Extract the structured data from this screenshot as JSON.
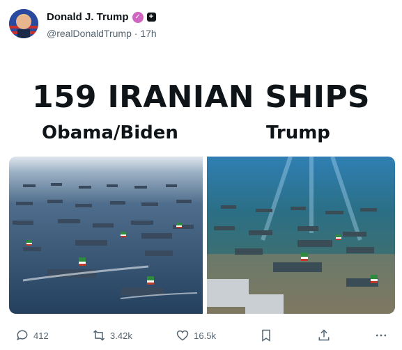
{
  "post": {
    "author_name": "Donald J. Trump",
    "handle": "@realDonaldTrump",
    "separator": "·",
    "time": "17h",
    "verified_badge_icon": "verified-badge-icon",
    "plus_icon": "plus-badge-icon",
    "plus_symbol": "+"
  },
  "media": {
    "headline": "159 IRANIAN SHIPS",
    "left_label": "Obama/Biden",
    "right_label": "Trump",
    "left_image": "fleet-of-iranian-ships-sailing",
    "right_image": "sunken-iranian-ships-on-seafloor"
  },
  "actions": {
    "reply_count": "412",
    "repost_count": "3.42k",
    "like_count": "16.5k",
    "reply_icon": "reply-icon",
    "repost_icon": "repost-icon",
    "like_icon": "heart-icon",
    "bookmark_icon": "bookmark-icon",
    "share_icon": "share-icon",
    "more_icon": "more-icon"
  },
  "colors": {
    "verified": "#d066c2",
    "text": "#0f1419",
    "secondary": "#536471"
  }
}
